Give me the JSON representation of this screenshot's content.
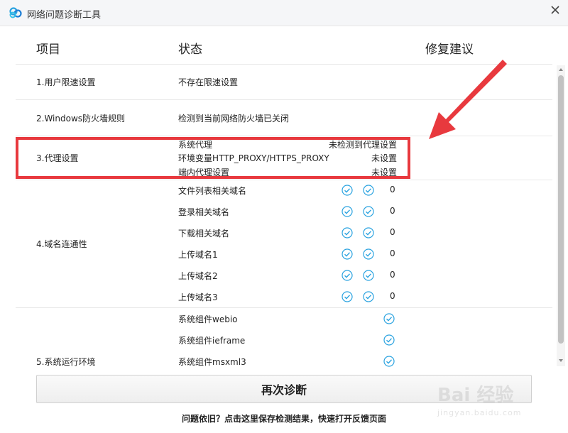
{
  "window": {
    "title": "网络问题诊断工具"
  },
  "columns": {
    "item": "项目",
    "status": "状态",
    "suggestion": "修复建议"
  },
  "rows": {
    "speed_limit": {
      "label": "1.用户限速设置",
      "status": "不存在限速设置"
    },
    "firewall": {
      "label": "2.Windows防火墙规则",
      "status": "检测到当前网络防火墙已关闭"
    },
    "proxy": {
      "label": "3.代理设置",
      "lines": [
        {
          "name": "系统代理",
          "value": "未检测到代理设置"
        },
        {
          "name": "环境变量HTTP_PROXY/HTTPS_PROXY",
          "value": "未设置"
        },
        {
          "name": "端内代理设置",
          "value": "未设置"
        }
      ]
    },
    "domain": {
      "label": "4.域名连通性",
      "lines": [
        {
          "name": "文件列表相关域名",
          "count": "0"
        },
        {
          "name": "登录相关域名",
          "count": "0"
        },
        {
          "name": "下载相关域名",
          "count": "0"
        },
        {
          "name": "上传域名1",
          "count": "0"
        },
        {
          "name": "上传域名2",
          "count": "0"
        },
        {
          "name": "上传域名3",
          "count": "0"
        }
      ]
    },
    "runtime": {
      "label": "5.系统运行环境",
      "lines": [
        {
          "name": "系统组件webio"
        },
        {
          "name": "系统组件ieframe"
        },
        {
          "name": "系统组件msxml3"
        }
      ]
    }
  },
  "buttons": {
    "rediagnose": "再次诊断"
  },
  "feedback_link": "问题依旧？点击这里保存检测结果，快速打开反馈页面",
  "watermark": {
    "text": "Bai 经验",
    "sub": "jingyan.baidu.com"
  },
  "colors": {
    "accent": "#2ba3e0",
    "highlight": "#e8393e"
  }
}
